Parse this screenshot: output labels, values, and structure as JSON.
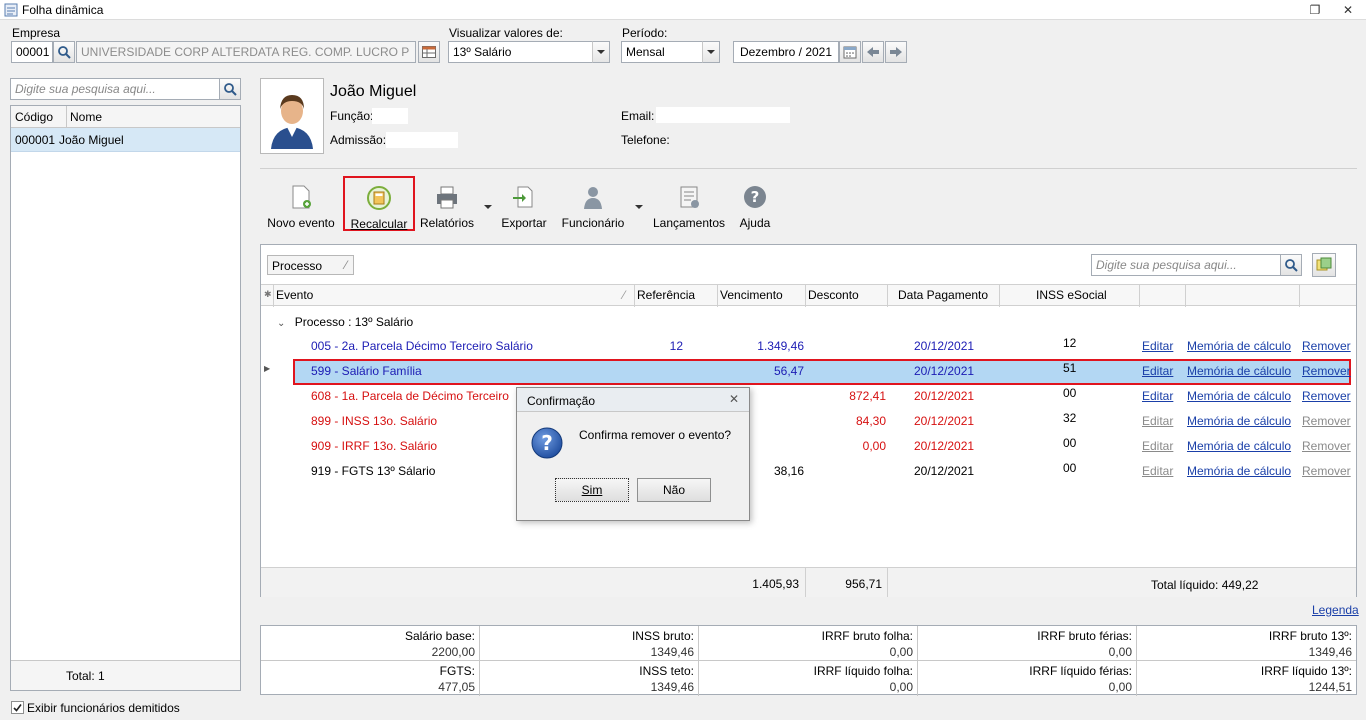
{
  "window": {
    "title": "Folha dinâmica"
  },
  "filters": {
    "empresa_label": "Empresa",
    "empresa_code": "00001",
    "empresa_name": "UNIVERSIDADE CORP ALTERDATA REG. COMP. LUCRO P",
    "visualizar_label": "Visualizar valores de:",
    "visualizar_value": "13º Salário",
    "periodo_label": "Período:",
    "periodo_value": "Mensal",
    "periodo_date": "Dezembro / 2021"
  },
  "sidebar": {
    "search_placeholder": "Digite sua pesquisa aqui...",
    "columns": [
      "Código",
      "Nome"
    ],
    "rows": [
      {
        "code": "000001",
        "name": "João Miguel"
      }
    ],
    "total_label": "Total: 1",
    "show_dismissed_label": "Exibir funcionários demitidos"
  },
  "employee": {
    "name": "João Miguel",
    "funcao_label": "Função:",
    "admissao_label": "Admissão:",
    "email_label": "Email:",
    "telefone_label": "Telefone:"
  },
  "toolbar": {
    "novo_evento": "Novo evento",
    "recalcular": "Recalcular",
    "relatorios": "Relatórios",
    "exportar": "Exportar",
    "funcionario": "Funcionário",
    "lancamentos": "Lançamentos",
    "ajuda": "Ajuda"
  },
  "grid": {
    "group_chip": "Processo",
    "search_placeholder": "Digite sua pesquisa aqui...",
    "columns": {
      "evento": "Evento",
      "referencia": "Referência",
      "vencimento": "Vencimento",
      "desconto": "Desconto",
      "data_pagamento": "Data Pagamento",
      "inss_esocial": "INSS eSocial"
    },
    "group_label": "Processo : 13º Salário",
    "actions": {
      "editar": "Editar",
      "memoria": "Memória de cálculo",
      "remover": "Remover"
    },
    "rows": [
      {
        "evento": "005 - 2a. Parcela Décimo Terceiro Salário",
        "referencia": "12",
        "vencimento": "1.349,46",
        "desconto": "",
        "data": "20/12/2021",
        "inss": "12"
      },
      {
        "evento": "599 - Salário Família",
        "referencia": "",
        "vencimento": "56,47",
        "desconto": "",
        "data": "20/12/2021",
        "inss": "51"
      },
      {
        "evento": "608 - 1a. Parcela de Décimo Terceiro",
        "referencia": "",
        "vencimento": "",
        "desconto": "872,41",
        "data": "20/12/2021",
        "inss": "00"
      },
      {
        "evento": "899 - INSS 13o. Salário",
        "referencia": "",
        "vencimento": "",
        "desconto": "84,30",
        "data": "20/12/2021",
        "inss": "32"
      },
      {
        "evento": "909 - IRRF 13o. Salário",
        "referencia": "",
        "vencimento": "",
        "desconto": "0,00",
        "data": "20/12/2021",
        "inss": "00"
      },
      {
        "evento": "919 - FGTS 13º Sálario",
        "referencia": "",
        "vencimento": "38,16",
        "desconto": "",
        "data": "20/12/2021",
        "inss": "00"
      }
    ],
    "totals": {
      "vencimento": "1.405,93",
      "desconto": "956,71",
      "liquido": "Total líquido: 449,22"
    },
    "legenda": "Legenda"
  },
  "summary": {
    "salario_base": {
      "label": "Salário base:",
      "value": "2200,00"
    },
    "inss_bruto": {
      "label": "INSS bruto:",
      "value": "1349,46"
    },
    "irrf_bruto_folha": {
      "label": "IRRF bruto folha:",
      "value": "0,00"
    },
    "irrf_bruto_ferias": {
      "label": "IRRF bruto férias:",
      "value": "0,00"
    },
    "irrf_bruto_13": {
      "label": "IRRF bruto 13º:",
      "value": "1349,46"
    },
    "fgts": {
      "label": "FGTS:",
      "value": "477,05"
    },
    "inss_teto": {
      "label": "INSS teto:",
      "value": "1349,46"
    },
    "irrf_liquido_folha": {
      "label": "IRRF líquido folha:",
      "value": "0,00"
    },
    "irrf_liquido_ferias": {
      "label": "IRRF líquido férias:",
      "value": "0,00"
    },
    "irrf_liquido_13": {
      "label": "IRRF líquido 13º:",
      "value": "1244,51"
    }
  },
  "dialog": {
    "title": "Confirmação",
    "message": "Confirma remover o evento?",
    "yes": "Sim",
    "no": "Não"
  },
  "colors": {
    "highlight": "#e0141e",
    "selection": "#b3d7f3",
    "link": "#1a3fa8",
    "blue_text": "#1c1cb4",
    "red_text": "#d61010"
  }
}
